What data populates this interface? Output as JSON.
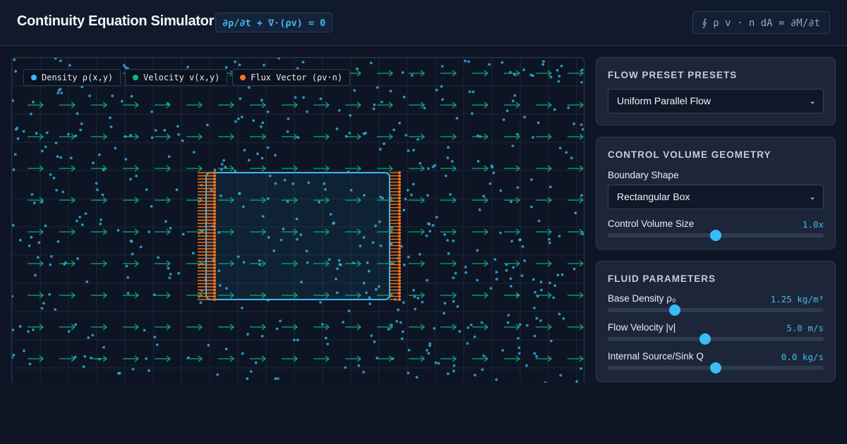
{
  "header": {
    "title": "Continuity Equation Simulator",
    "equation": "∂ρ/∂t + ∇·(ρv) = 0",
    "integral_form": "∮ ρ v · n dA = ∂M/∂t"
  },
  "legend": [
    {
      "label": "Density ρ(x,y)",
      "color": "#38bdf8"
    },
    {
      "label": "Velocity v(x,y)",
      "color": "#10b981"
    },
    {
      "label": "Flux Vector (ρv·n)",
      "color": "#f97316"
    }
  ],
  "field": {
    "velocity_color": "#10b981",
    "density_color": "#38bdf8",
    "flux_color": "#f97316",
    "boundary_color": "#38bdf8"
  },
  "presets": {
    "title": "Flow Preset Presets",
    "selected": "Uniform Parallel Flow"
  },
  "geometry": {
    "title": "Control Volume Geometry",
    "shape_label": "Boundary Shape",
    "shape_selected": "Rectangular Box",
    "size_label": "Control Volume Size",
    "size_value": "1.0x",
    "size_level": 0.5
  },
  "fluid": {
    "title": "Fluid Parameters",
    "density_label": "Base Density ρ₀",
    "density_value": "1.25 kg/m³",
    "density_level": 0.31,
    "velocity_label": "Flow Velocity |v|",
    "velocity_value": "5.0 m/s",
    "velocity_level": 0.45,
    "source_label": "Internal Source/Sink Q",
    "source_value": "0.0 kg/s",
    "source_level": 0.5
  }
}
